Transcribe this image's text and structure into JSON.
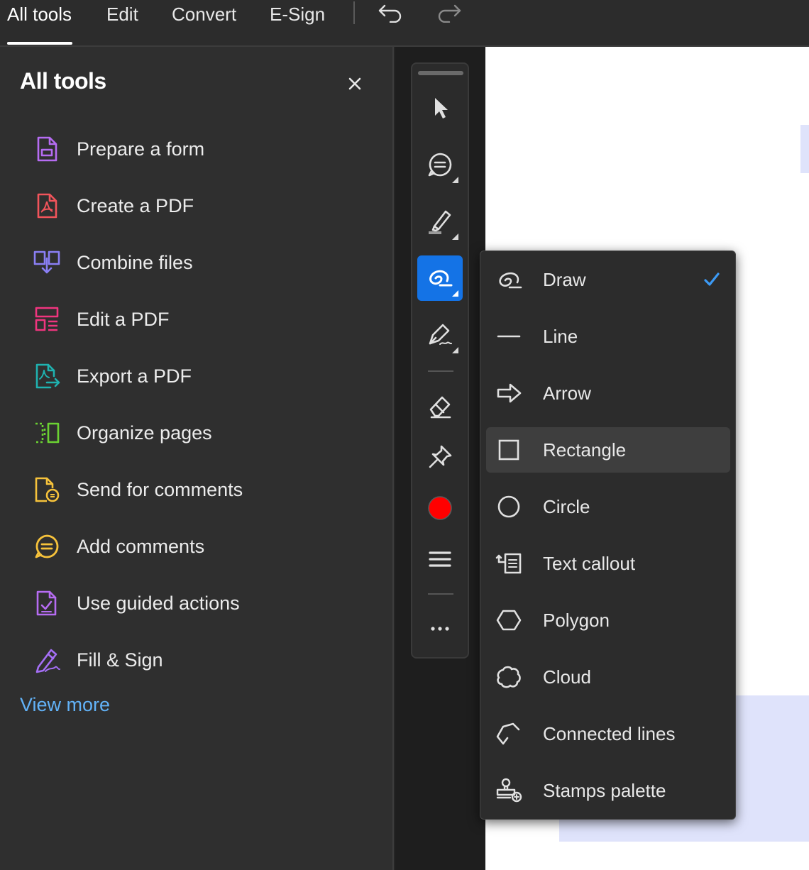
{
  "topbar": {
    "tabs": [
      "All tools",
      "Edit",
      "Convert",
      "E-Sign"
    ],
    "active_tab": "All tools"
  },
  "sidebar": {
    "title": "All tools",
    "items": [
      {
        "label": "Prepare a form",
        "icon": "form-icon",
        "color": "#b66cf2"
      },
      {
        "label": "Create a PDF",
        "icon": "pdf-icon",
        "color": "#f2545b"
      },
      {
        "label": "Combine files",
        "icon": "combine-icon",
        "color": "#8a7ff4"
      },
      {
        "label": "Edit a PDF",
        "icon": "edit-pdf-icon",
        "color": "#f0357f"
      },
      {
        "label": "Export a PDF",
        "icon": "export-icon",
        "color": "#1fb2b0"
      },
      {
        "label": "Organize pages",
        "icon": "organize-icon",
        "color": "#6bd232"
      },
      {
        "label": "Send for comments",
        "icon": "send-comments-icon",
        "color": "#f6c23b"
      },
      {
        "label": "Add comments",
        "icon": "comment-icon",
        "color": "#f6c23b"
      },
      {
        "label": "Use guided actions",
        "icon": "guided-actions-icon",
        "color": "#b66cf2"
      },
      {
        "label": "Fill & Sign",
        "icon": "fill-sign-icon",
        "color": "#a56ff6"
      }
    ],
    "view_more": "View more"
  },
  "toolbar": {
    "tools": [
      "select-icon",
      "comment-icon",
      "highlight-icon",
      "draw-icon",
      "pen-icon",
      "eraser-icon",
      "pin-icon",
      "color-swatch",
      "line-weight-icon",
      "more-icon"
    ],
    "active_tool": "draw-icon",
    "current_color": "#ff0000",
    "accent": "#1473e6"
  },
  "dropdown": {
    "items": [
      {
        "label": "Draw",
        "icon": "draw-icon",
        "checked": true
      },
      {
        "label": "Line",
        "icon": "line-icon"
      },
      {
        "label": "Arrow",
        "icon": "arrow-icon"
      },
      {
        "label": "Rectangle",
        "icon": "rectangle-icon",
        "hovered": true
      },
      {
        "label": "Circle",
        "icon": "circle-icon"
      },
      {
        "label": "Text callout",
        "icon": "text-callout-icon"
      },
      {
        "label": "Polygon",
        "icon": "polygon-icon"
      },
      {
        "label": "Cloud",
        "icon": "cloud-icon"
      },
      {
        "label": "Connected lines",
        "icon": "connected-lines-icon"
      },
      {
        "label": "Stamps palette",
        "icon": "stamp-icon"
      }
    ],
    "check_color": "#3c9af5"
  }
}
